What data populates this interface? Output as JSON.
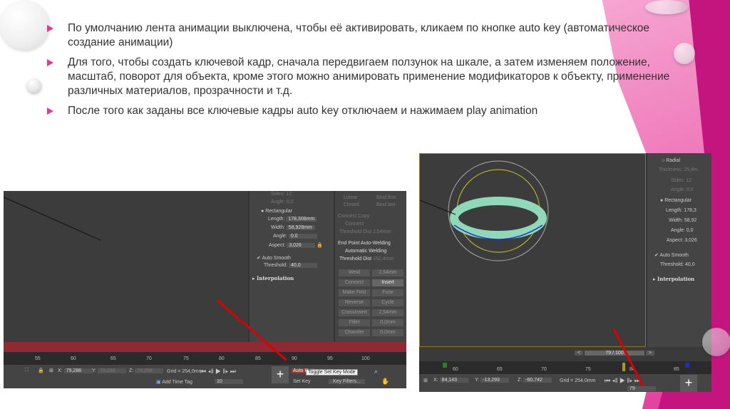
{
  "bullets": [
    "По умолчанию лента анимации выключена, чтобы её активировать, кликаем по кнопке auto key (автоматическое создание анимации)",
    "Для того, чтобы создать ключевой кадр, сначала передвигаем ползунок на шкале, а затем изменяем положение, масштаб, поворот для объекта, кроме этого можно анимировать применение модификаторов к объекту, применение различных материалов, прозрачности и т.д.",
    "После того как заданы все ключевые кадры auto key отключаем и нажимаем play animation"
  ],
  "left": {
    "sides": "Sides: 12",
    "angle_top": "Angle: 0,0",
    "rectangular": "Rectangular",
    "length": "Length:",
    "length_v": "178,308mm",
    "width": "Width:",
    "width_v": "58,928mm",
    "angle": "Angle:",
    "angle_v": "0,0",
    "aspect": "Aspect:",
    "aspect_v": "3,026",
    "auto_smooth": "Auto Smooth",
    "threshold": "Threshold:",
    "threshold_v": "40,0",
    "interpolation": "Interpolation",
    "linear": "Linear",
    "bind_first": "Bind first",
    "closed": "Closed",
    "bind_last": "Bind last",
    "connect_copy": "Connect Copy",
    "connect": "Connect",
    "thr_dist": "Threshold Dist",
    "thr_dist_v": "2,54mm",
    "end_weld": "End Point Auto-Welding",
    "auto_weld": "Automatic Welding",
    "thr_dist2_v": "152,4mm",
    "buttons": [
      "Weld",
      "2,54mm",
      "Connect",
      "Insert",
      "Make First",
      "Fuse",
      "Reverse",
      "Cycle",
      "CrossInsert",
      "2,54mm",
      "Fillet",
      "0,0mm",
      "Chamfer",
      "0,0mm"
    ],
    "ticks": [
      "55",
      "60",
      "65",
      "70",
      "75",
      "80",
      "85",
      "90",
      "95",
      "100"
    ],
    "x": "X:",
    "x_v": "79,288",
    "y": "Y:",
    "y_v": "79,288",
    "z": "Z:",
    "z_v": "79,288",
    "grid": "Grid = 254,0mm",
    "add_time_tag": "Add Time Tag",
    "frame": "10",
    "auto_key": "Auto Key",
    "set_key": "Set Key",
    "key_filters": "Key Filters...",
    "tooltip": "Toggle Set Key Mode"
  },
  "right": {
    "radial": "Radial",
    "thickness": "Thickness: 25,4m",
    "sides": "Sides: 12",
    "angle_top": "Angle: 0,0",
    "rectangular": "Rectangular",
    "length": "Length: 178,3",
    "width": "Width: 58,92",
    "angle": "Angle: 0,0",
    "aspect": "Aspect: 3,026",
    "auto_smooth": "Auto Smooth",
    "threshold": "Threshold: 40,0",
    "interpolation": "Interpolation",
    "time": "79 / 100",
    "ticks": [
      "60",
      "65",
      "70",
      "75",
      "80",
      "85"
    ],
    "x": "X:",
    "x_v": "84,143",
    "y": "Y:",
    "y_v": "-13,293",
    "z": "Z:",
    "z_v": "-60,742",
    "grid": "Grid = 254,0mm",
    "frame": "79"
  },
  "colors": {
    "accent": "#d93c93",
    "key_green": "#1a8a1a",
    "key_blue": "#1d2bd0",
    "key_yellow": "#a89a20"
  }
}
